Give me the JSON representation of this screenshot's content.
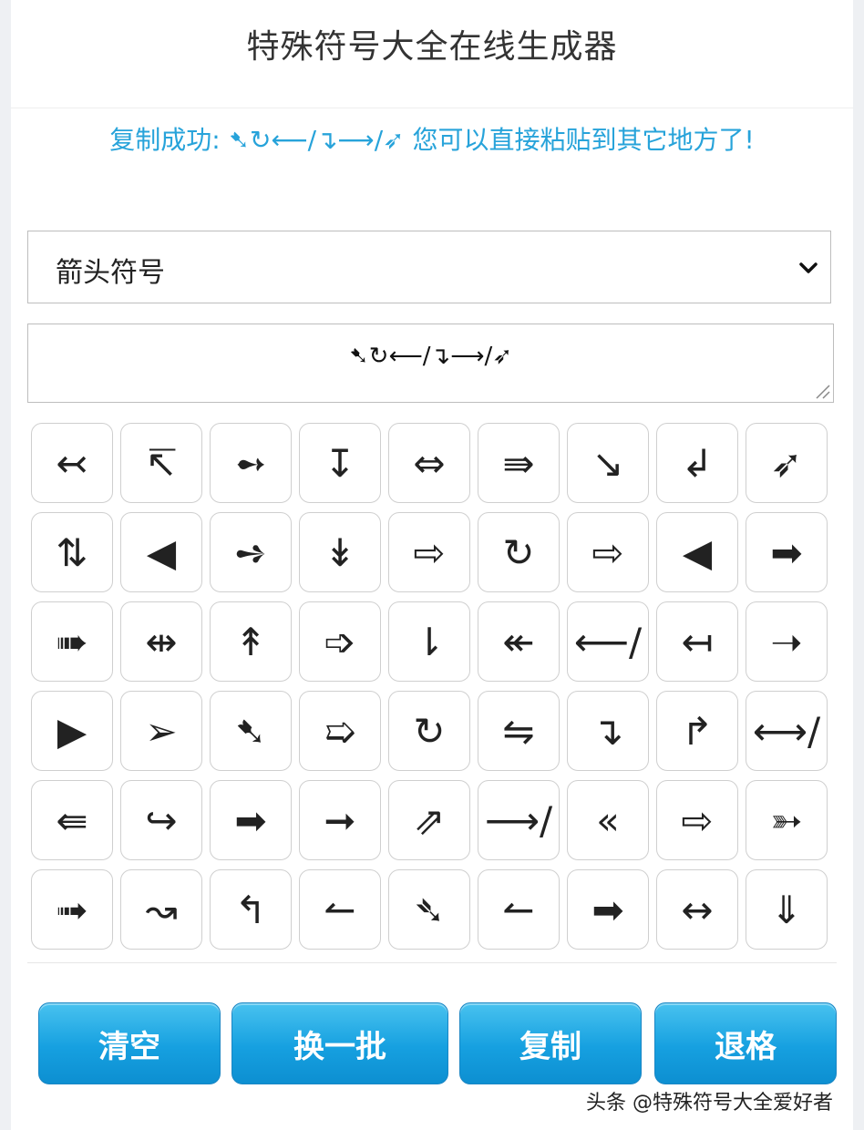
{
  "title": "特殊符号大全在线生成器",
  "notice": "复制成功: ➷↻⟵/↴⟶/➶ 您可以直接粘贴到其它地方了!",
  "category_select": {
    "value": "箭头符号",
    "icon": "chevron-down-icon"
  },
  "output": {
    "value": "➷↻⟵/↴⟶/➶"
  },
  "symbols": [
    "↢",
    "↸",
    "➻",
    "↧",
    "⇔",
    "⇛",
    "↘",
    "↲",
    "➶",
    "⇅",
    "◀",
    "➺",
    "↡",
    "⇨",
    "↻",
    "⇨",
    "◀",
    "➡",
    "➠",
    "⇹",
    "↟",
    "➩",
    "⇂",
    "↞",
    "⟵/",
    "↤",
    "➝",
    "▶",
    "➢",
    "➷",
    "➯",
    "↻",
    "⇋",
    "↴",
    "↱",
    "⟷/",
    "⇚",
    "↪",
    "➡",
    "➞",
    "⇗",
    "⟶/",
    "«",
    "⇨",
    "➳",
    "➟",
    "↝",
    "↰",
    "↼",
    "➴",
    "↼",
    "➡",
    "↔",
    "⇓"
  ],
  "buttons": {
    "clear": "清空",
    "shuffle": "换一批",
    "copy": "复制",
    "backspace": "退格"
  },
  "watermark": "头条 @特殊符号大全爱好者",
  "colors": {
    "accent": "#27a3da",
    "button": "#16a0e0"
  }
}
